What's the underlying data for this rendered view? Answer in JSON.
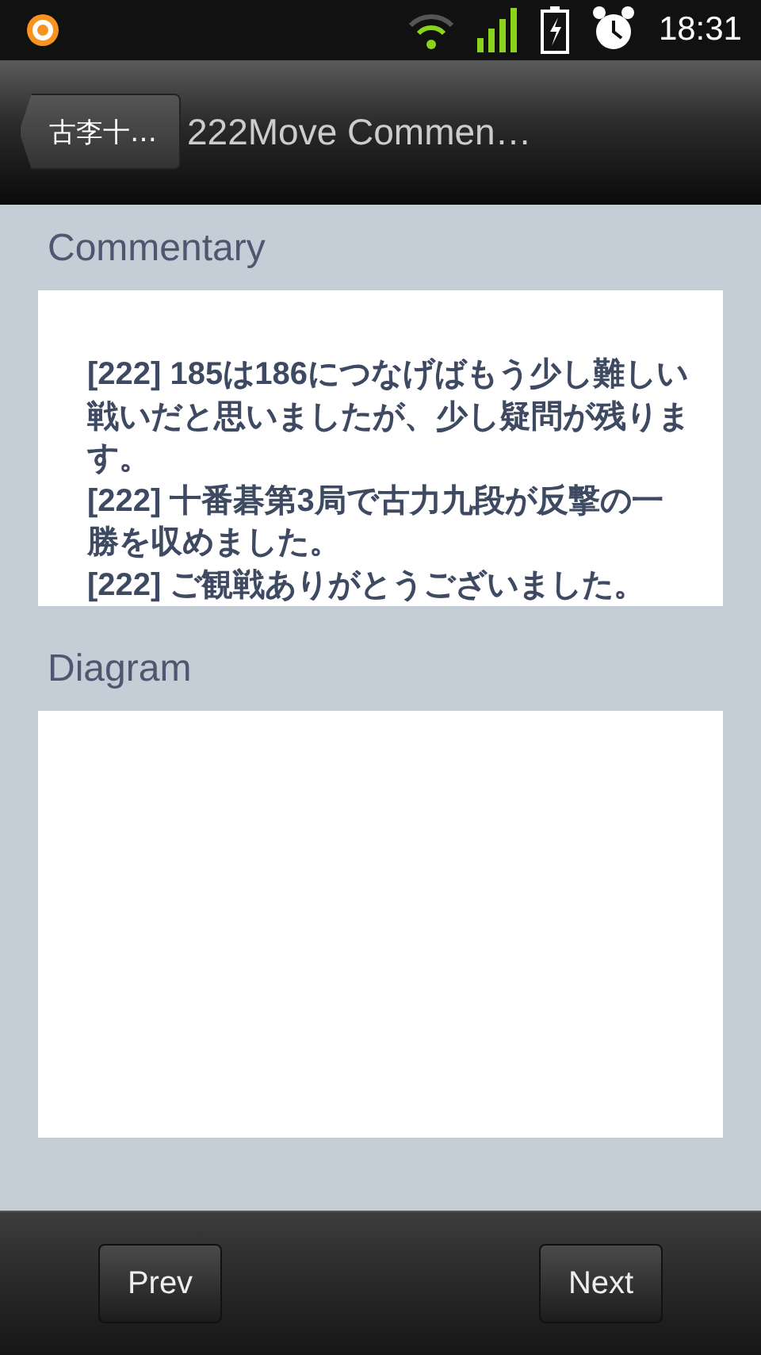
{
  "status_bar": {
    "time": "18:31"
  },
  "action_bar": {
    "back_label": "古李十…",
    "title": "222Move Commen…"
  },
  "commentary": {
    "heading": "Commentary",
    "entries": [
      {
        "text": "[222] 185は186につなげばもう少し難しい戦いだと思いましたが、少し疑問が残ります。"
      },
      {
        "text": "[222] 十番碁第3局で古力九段が反撃の一勝を収めました。"
      },
      {
        "text": "[222] ご観戦ありがとうございました。"
      }
    ]
  },
  "diagram": {
    "heading": "Diagram"
  },
  "buttons": [
    {
      "label": "Prev"
    },
    {
      "label": "Next"
    }
  ]
}
